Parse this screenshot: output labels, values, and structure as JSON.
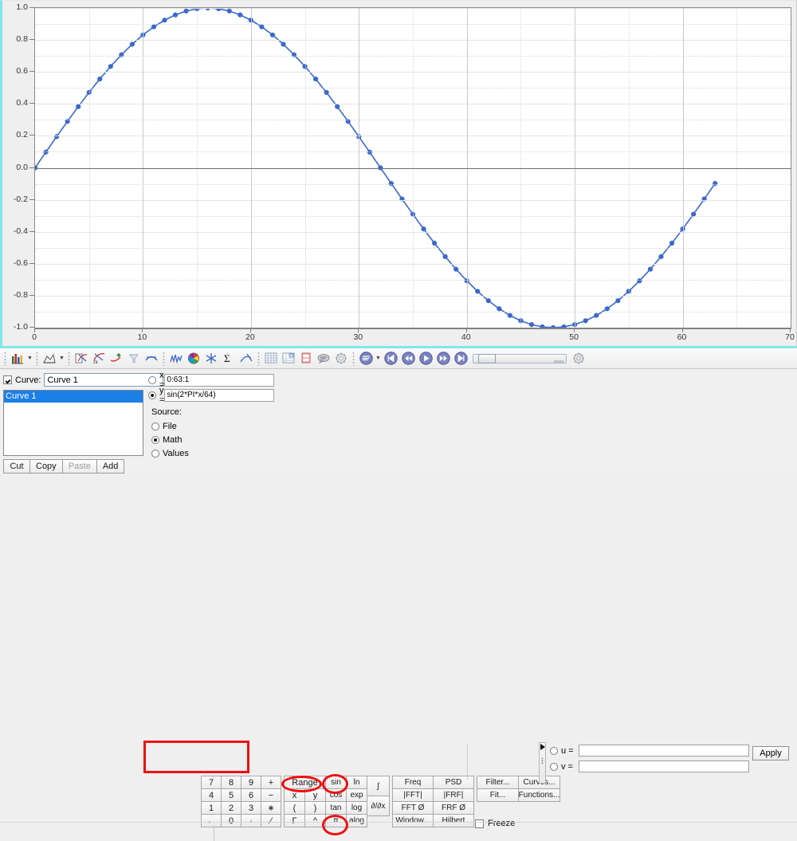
{
  "chart_data": {
    "type": "line",
    "title": "",
    "xlabel": "",
    "ylabel": "",
    "xlim": [
      0,
      70
    ],
    "ylim": [
      -1.0,
      1.0
    ],
    "xticks": [
      0,
      10,
      20,
      30,
      40,
      50,
      60,
      70
    ],
    "yticks": [
      1.0,
      0.8,
      0.6,
      0.4,
      0.2,
      0.0,
      -0.2,
      -0.4,
      -0.6,
      -0.8,
      -1.0
    ],
    "ytick_labels": [
      "1.0",
      "0.8",
      "0.6",
      "0.4",
      "0.2",
      "0.0",
      "-0.2",
      "-0.4",
      "-0.6",
      "-0.8",
      "-1.0"
    ],
    "xtick_labels": [
      "0",
      "10",
      "20",
      "30",
      "40",
      "50",
      "60",
      "70"
    ],
    "grid": true,
    "legend": "none",
    "series": [
      {
        "name": "Curve 1",
        "expression": "sin(2*PI*x/64)",
        "color": "#3b69cc",
        "marker": "circle",
        "x_range": "0:63:1",
        "x_start": 0,
        "x_stop": 63,
        "x_step": 1,
        "period": 64,
        "amplitude": 1.0,
        "n_points": 64
      }
    ]
  },
  "toolbar": {
    "groups": [
      {
        "items": [
          {
            "icon": "chart-type-icon",
            "label": ""
          },
          {
            "icon": "caret-down-icon",
            "label": ""
          }
        ]
      },
      {
        "items": [
          {
            "icon": "area-plot-icon",
            "label": ""
          },
          {
            "icon": "caret-down-icon",
            "label": ""
          }
        ]
      },
      {
        "items": [
          {
            "icon": "new-curve-icon",
            "label": ""
          },
          {
            "icon": "curve-fx-icon",
            "label": ""
          },
          {
            "icon": "add-curve-icon",
            "label": ""
          },
          {
            "icon": "filter-funnel-icon",
            "label": ""
          },
          {
            "icon": "smooth-curve-icon",
            "label": ""
          }
        ]
      },
      {
        "items": [
          {
            "icon": "noise-signal-icon",
            "label": ""
          },
          {
            "icon": "color-wheel-icon",
            "label": ""
          },
          {
            "icon": "asterisk-icon",
            "label": ""
          },
          {
            "icon": "sigma-icon",
            "label": ""
          },
          {
            "icon": "derivative-icon",
            "label": ""
          }
        ]
      },
      {
        "items": [
          {
            "icon": "grid-icon",
            "label": ""
          },
          {
            "icon": "table-icon",
            "label": ""
          },
          {
            "icon": "document-icon",
            "label": ""
          },
          {
            "icon": "comment-icon",
            "label": ""
          },
          {
            "icon": "settings-gear-icon",
            "label": ""
          }
        ]
      },
      {
        "items": [
          {
            "icon": "playback-mode-icon",
            "label": ""
          },
          {
            "icon": "caret-down-icon",
            "label": ""
          },
          {
            "icon": "skip-start-icon",
            "label": ""
          },
          {
            "icon": "rewind-icon",
            "label": ""
          },
          {
            "icon": "play-icon",
            "label": ""
          },
          {
            "icon": "fast-forward-icon",
            "label": ""
          },
          {
            "icon": "skip-end-icon",
            "label": ""
          },
          {
            "icon": "timeline-slider",
            "label": ""
          },
          {
            "icon": "playback-settings-icon",
            "label": ""
          }
        ]
      }
    ]
  },
  "curve_panel": {
    "checkbox_checked": true,
    "curve_label": "Curve:",
    "curve_name_value": "Curve 1",
    "list_items": [
      {
        "label": "Curve 1",
        "selected": true
      }
    ],
    "buttons": [
      {
        "label": "Cut",
        "disabled": false
      },
      {
        "label": "Copy",
        "disabled": false
      },
      {
        "label": "Paste",
        "disabled": true
      },
      {
        "label": "Add",
        "disabled": false
      }
    ]
  },
  "expression": {
    "x_radio_selected": false,
    "x_key": "x =",
    "x_value": "0:63:1",
    "y_radio_selected": true,
    "y_key": "y =",
    "y_value": "sin(2*PI*x/64)",
    "highlight_color": "#ee1111"
  },
  "source": {
    "title": "Source:",
    "options": [
      {
        "label": "File",
        "selected": false
      },
      {
        "label": "Math",
        "selected": true
      },
      {
        "label": "Values",
        "selected": false
      }
    ]
  },
  "keypad": {
    "numeric": [
      "7",
      "8",
      "9",
      "+",
      "4",
      "5",
      "6",
      "−",
      "1",
      "2",
      "3",
      "∗",
      "←",
      "0",
      "·",
      "∕"
    ],
    "ops": [
      "Range",
      "x",
      "(",
      "Γ",
      "y",
      ")",
      "^"
    ],
    "ops_grid": [
      "Range",
      "",
      "x",
      "y",
      "(",
      ")",
      "Γ",
      "^"
    ],
    "funcs": [
      "sin",
      "ln",
      "cos",
      "exp",
      "tan",
      "log",
      "π",
      "alog"
    ],
    "calculus": [
      "∫",
      "∂/∂x"
    ],
    "analysis": [
      "Freq",
      "PSD",
      "|FFT|",
      "|FRF|",
      "FFT Ø",
      "FRF Ø",
      "Window...",
      "Hilbert"
    ],
    "tools": [
      "Filter...",
      "Curves...",
      "Fit...",
      "Functions..."
    ],
    "freeze_label": "Freeze",
    "freeze_checked": false,
    "annotated": [
      "Range",
      "sin",
      "π"
    ]
  },
  "right_panel": {
    "u_radio_selected": false,
    "u_key": "u =",
    "u_value": "",
    "v_radio_selected": false,
    "v_key": "v =",
    "v_value": "",
    "apply_label": "Apply"
  },
  "colors": {
    "curve": "#3b69cc",
    "selection": "#1c7fe8",
    "annotation": "#ee1111",
    "chart_border": "#7fe7ec",
    "panel_bg": "#f0f0f0"
  }
}
